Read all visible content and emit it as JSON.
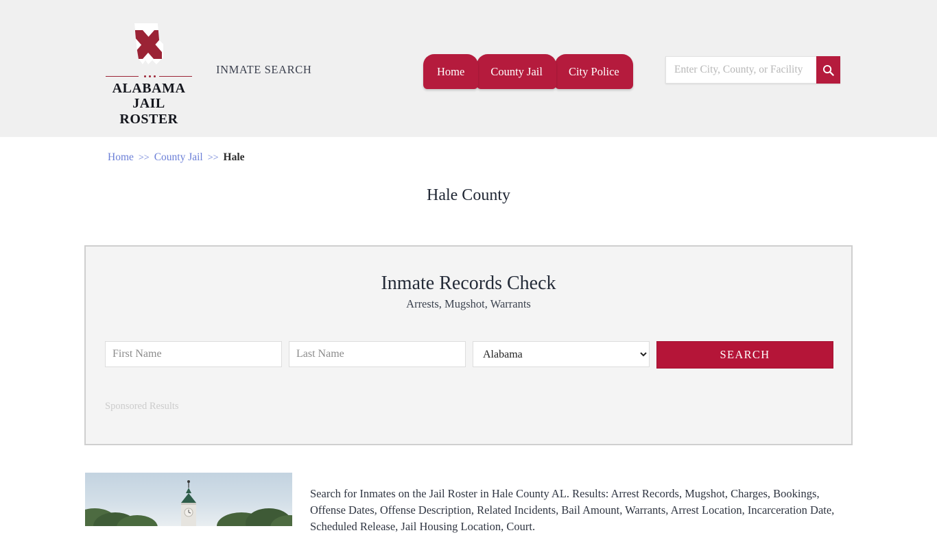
{
  "header": {
    "logo": {
      "line1": "ALABAMA",
      "line2": "JAIL ROSTER",
      "icon": "alabama-state-flag-icon"
    },
    "tagline": "INMATE SEARCH",
    "nav": [
      {
        "label": "Home"
      },
      {
        "label": "County Jail"
      },
      {
        "label": "City Police"
      }
    ],
    "search": {
      "placeholder": "Enter City, County, or Facility",
      "value": "",
      "button_icon": "search-icon"
    },
    "background_color": "#f0f0f0",
    "accent_color": "#b51b3d"
  },
  "breadcrumb": {
    "items": [
      {
        "label": "Home",
        "link": true
      },
      {
        "label": "County Jail",
        "link": true
      },
      {
        "label": "Hale",
        "link": false
      }
    ],
    "separator": ">>"
  },
  "page": {
    "title": "Hale County"
  },
  "sponsor_panel": {
    "title": "Inmate Records Check",
    "subtitle": "Arrests, Mugshot, Warrants",
    "form": {
      "first_name_placeholder": "First Name",
      "first_name_value": "",
      "last_name_placeholder": "Last Name",
      "last_name_value": "",
      "state_selected": "Alabama",
      "state_options": [
        "Alabama"
      ],
      "submit_label": "SEARCH",
      "submit_color": "#b51538"
    },
    "sponsored_label": "Sponsored Results"
  },
  "content": {
    "thumbnail_alt": "hale-county-courthouse-photo",
    "description": "Search for Inmates on the Jail Roster in Hale County AL. Results: Arrest Records, Mugshot, Charges, Bookings, Offense Dates, Offense Description, Related Incidents, Bail Amount, Warrants, Arrest Location, Incarceration Date, Scheduled Release, Jail Housing Location, Court."
  }
}
